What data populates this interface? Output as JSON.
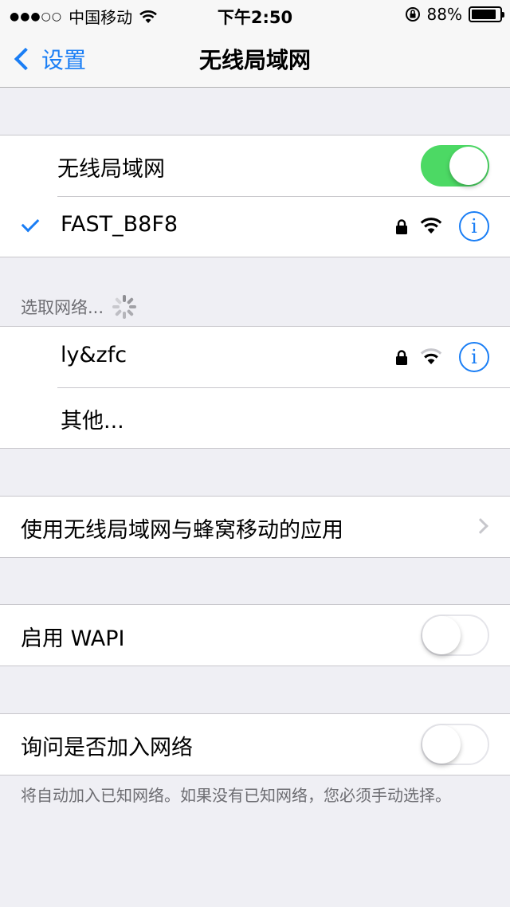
{
  "status_bar": {
    "carrier": "中国移动",
    "time": "下午2:50",
    "battery": "88%",
    "battery_level": 0.88
  },
  "nav": {
    "back_label": "设置",
    "title": "无线局域网"
  },
  "wifi_group": {
    "toggle_label": "无线局域网",
    "toggle_on": true,
    "connected_network": "FAST_B8F8"
  },
  "choose_network": {
    "header": "选取网络...",
    "networks": [
      {
        "name": "ly&zfc",
        "secured": true
      }
    ],
    "other_label": "其他..."
  },
  "apps_row": {
    "label": "使用无线局域网与蜂窝移动的应用"
  },
  "wapi": {
    "label": "启用 WAPI",
    "toggle_on": false
  },
  "ask_join": {
    "label": "询问是否加入网络",
    "toggle_on": false,
    "note": "将自动加入已知网络。如果没有已知网络，您必须手动选择。"
  },
  "colors": {
    "accent": "#1a7ef5",
    "toggle_on": "#4cd964",
    "background": "#efeff4"
  }
}
